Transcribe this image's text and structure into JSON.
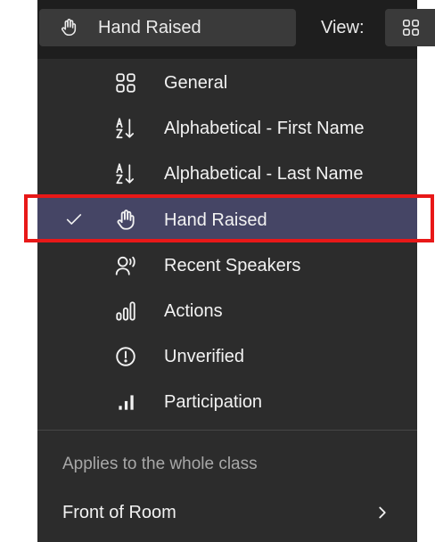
{
  "header": {
    "sort_label": "Hand Raised",
    "sort_icon": "hand-raised-icon",
    "view_label": "View:",
    "view_icon": "grid-icon"
  },
  "menu": {
    "items": [
      {
        "label": "General",
        "icon": "grid-icon",
        "selected": false
      },
      {
        "label": "Alphabetical - First Name",
        "icon": "sort-az-icon",
        "selected": false
      },
      {
        "label": "Alphabetical - Last Name",
        "icon": "sort-az-icon",
        "selected": false
      },
      {
        "label": "Hand Raised",
        "icon": "hand-raised-icon",
        "selected": true
      },
      {
        "label": "Recent Speakers",
        "icon": "speaker-icon",
        "selected": false
      },
      {
        "label": "Actions",
        "icon": "actions-icon",
        "selected": false
      },
      {
        "label": "Unverified",
        "icon": "exclamation-circle-icon",
        "selected": false
      },
      {
        "label": "Participation",
        "icon": "bar-chart-icon",
        "selected": false
      }
    ],
    "section_label": "Applies to the whole class",
    "front_of_room": {
      "label": "Front of Room",
      "icon": "chevron-right-icon"
    }
  },
  "colors": {
    "panel_bg": "#2c2c2c",
    "selected_bg": "#454565",
    "highlight_border": "#e81818",
    "text": "#f2f2f2",
    "muted_text": "#a8a8a8"
  }
}
